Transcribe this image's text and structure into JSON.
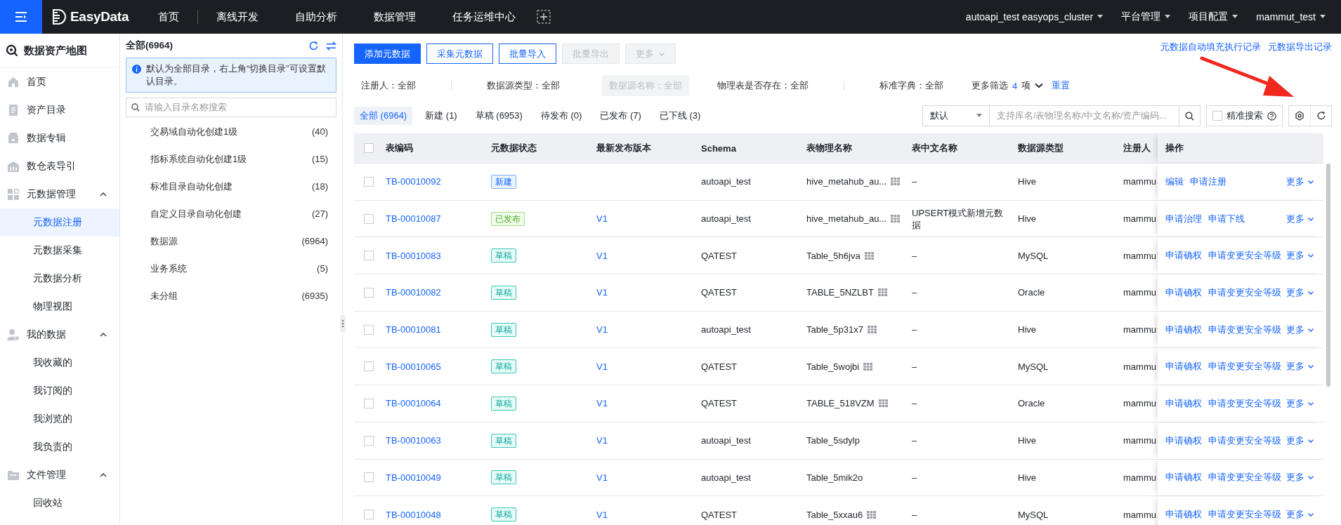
{
  "topbar": {
    "logo": "EasyData",
    "nav": [
      "首页",
      "离线开发",
      "自助分析",
      "数据管理",
      "任务运维中心"
    ],
    "menus": [
      "autoapi_test  easyops_cluster",
      "平台管理",
      "项目配置",
      "mammut_test"
    ]
  },
  "sidebar": {
    "title": "数据资产地图",
    "items": [
      {
        "label": "首页",
        "selected": false
      },
      {
        "label": "资产目录",
        "selected": false
      },
      {
        "label": "数据专辑",
        "selected": false
      },
      {
        "label": "数仓表导引",
        "selected": false
      },
      {
        "label": "元数据管理",
        "expanded": true,
        "children": [
          {
            "label": "元数据注册",
            "selected": true
          },
          {
            "label": "元数据采集",
            "selected": false
          },
          {
            "label": "元数据分析",
            "selected": false
          },
          {
            "label": "物理视图",
            "selected": false
          }
        ]
      },
      {
        "label": "我的数据",
        "expanded": true,
        "children": [
          {
            "label": "我收藏的",
            "selected": false
          },
          {
            "label": "我订阅的",
            "selected": false
          },
          {
            "label": "我浏览的",
            "selected": false
          },
          {
            "label": "我负责的",
            "selected": false
          }
        ]
      },
      {
        "label": "文件管理",
        "expanded": true,
        "children": [
          {
            "label": "回收站",
            "selected": false
          }
        ]
      }
    ]
  },
  "directory": {
    "title": "全部(6964)",
    "notice": "默认为全部目录，右上角“切换目录”可设置默认目录。",
    "search_placeholder": "请输入目录名称搜索",
    "items": [
      {
        "label": "交易域自动化创建1级",
        "count": "(40)"
      },
      {
        "label": "指标系统自动化创建1级",
        "count": "(15)"
      },
      {
        "label": "标准目录自动化创建",
        "count": "(18)"
      },
      {
        "label": "自定义目录自动化创建",
        "count": "(27)"
      },
      {
        "label": "数据源",
        "count": "(6964)"
      },
      {
        "label": "业务系统",
        "count": "(5)"
      },
      {
        "label": "未分组",
        "count": "(6935)"
      }
    ]
  },
  "actions": [
    {
      "label": "添加元数据",
      "kind": "primary",
      "disabled": false,
      "dropdown": false
    },
    {
      "label": "采集元数据",
      "kind": "outline",
      "disabled": false,
      "dropdown": false
    },
    {
      "label": "批量导入",
      "kind": "outline",
      "disabled": false,
      "dropdown": false
    },
    {
      "label": "批量导出",
      "kind": "outline",
      "disabled": true,
      "dropdown": false
    },
    {
      "label": "更多",
      "kind": "outline",
      "disabled": true,
      "dropdown": true
    }
  ],
  "record_links": [
    "元数据自动填充执行记录",
    "元数据导出记录"
  ],
  "filters": [
    {
      "label": "注册人：全部",
      "disabled": false
    },
    {
      "label": "数据源类型：全部",
      "disabled": false
    },
    {
      "label": "数据源名称：全部",
      "disabled": true
    },
    {
      "label": "物理表是否存在：全部",
      "disabled": false
    },
    {
      "label": "标准字典：全部",
      "disabled": false
    }
  ],
  "more_filters": {
    "label": "更多筛选",
    "count": "4",
    "unit": "项",
    "reset": "重置"
  },
  "status_tabs": [
    {
      "label": "全部 (6964)",
      "selected": true
    },
    {
      "label": "新建 (1)",
      "selected": false
    },
    {
      "label": "草稿 (6953)",
      "selected": false
    },
    {
      "label": "待发布 (0)",
      "selected": false
    },
    {
      "label": "已发布 (7)",
      "selected": false
    },
    {
      "label": "已下线 (3)",
      "selected": false
    }
  ],
  "search": {
    "scope": "默认",
    "placeholder": "支持库名/表物理名称/中文名称/资产编码...",
    "precise": {
      "label": "精准搜索",
      "checked": false
    }
  },
  "table": {
    "select_all_checked": false,
    "columns": [
      "表编码",
      "元数据状态",
      "最新发布版本",
      "Schema",
      "表物理名称",
      "表中文名称",
      "数据源类型",
      "注册人",
      "操作"
    ],
    "rows": [
      {
        "checked": false,
        "code": "TB-00010092",
        "status": {
          "label": "新建",
          "kind": "new"
        },
        "version": "",
        "schema": "autoapi_test",
        "physical_name": "hive_metahub_au...",
        "preview": true,
        "cn_name": "–",
        "source_type": "Hive",
        "registrant": "mammu",
        "ops": [
          "编辑",
          "申请注册"
        ],
        "more": "更多"
      },
      {
        "checked": false,
        "code": "TB-00010087",
        "status": {
          "label": "已发布",
          "kind": "published"
        },
        "version": "V1",
        "schema": "autoapi_test",
        "physical_name": "hive_metahub_au...",
        "preview": true,
        "cn_name": "UPSERT模式新增元数据",
        "source_type": "Hive",
        "registrant": "mammu",
        "ops": [
          "申请治理",
          "申请下线"
        ],
        "more": "更多"
      },
      {
        "checked": false,
        "code": "TB-00010083",
        "status": {
          "label": "草稿",
          "kind": "draft"
        },
        "version": "V1",
        "schema": "QATEST",
        "physical_name": "Table_5h6jva",
        "preview": true,
        "cn_name": "–",
        "source_type": "MySQL",
        "registrant": "mammu",
        "ops": [
          "申请确权",
          "申请变更安全等级"
        ],
        "more": "更多"
      },
      {
        "checked": false,
        "code": "TB-00010082",
        "status": {
          "label": "草稿",
          "kind": "draft"
        },
        "version": "V1",
        "schema": "QATEST",
        "physical_name": "TABLE_5NZLBT",
        "preview": true,
        "cn_name": "–",
        "source_type": "Oracle",
        "registrant": "mammu",
        "ops": [
          "申请确权",
          "申请变更安全等级"
        ],
        "more": "更多"
      },
      {
        "checked": false,
        "code": "TB-00010081",
        "status": {
          "label": "草稿",
          "kind": "draft"
        },
        "version": "V1",
        "schema": "autoapi_test",
        "physical_name": "Table_5p31x7",
        "preview": true,
        "cn_name": "–",
        "source_type": "Hive",
        "registrant": "mammu",
        "ops": [
          "申请确权",
          "申请变更安全等级"
        ],
        "more": "更多"
      },
      {
        "checked": false,
        "code": "TB-00010065",
        "status": {
          "label": "草稿",
          "kind": "draft"
        },
        "version": "V1",
        "schema": "QATEST",
        "physical_name": "Table_5wojbi",
        "preview": true,
        "cn_name": "–",
        "source_type": "MySQL",
        "registrant": "mammu",
        "ops": [
          "申请确权",
          "申请变更安全等级"
        ],
        "more": "更多"
      },
      {
        "checked": false,
        "code": "TB-00010064",
        "status": {
          "label": "草稿",
          "kind": "draft"
        },
        "version": "V1",
        "schema": "QATEST",
        "physical_name": "TABLE_518VZM",
        "preview": true,
        "cn_name": "–",
        "source_type": "Oracle",
        "registrant": "mammu",
        "ops": [
          "申请确权",
          "申请变更安全等级"
        ],
        "more": "更多"
      },
      {
        "checked": false,
        "code": "TB-00010063",
        "status": {
          "label": "草稿",
          "kind": "draft"
        },
        "version": "V1",
        "schema": "autoapi_test",
        "physical_name": "Table_5sdylp",
        "preview": false,
        "cn_name": "–",
        "source_type": "Hive",
        "registrant": "mammu",
        "ops": [
          "申请确权",
          "申请变更安全等级"
        ],
        "more": "更多"
      },
      {
        "checked": false,
        "code": "TB-00010049",
        "status": {
          "label": "草稿",
          "kind": "draft"
        },
        "version": "V1",
        "schema": "autoapi_test",
        "physical_name": "Table_5mik2o",
        "preview": false,
        "cn_name": "–",
        "source_type": "Hive",
        "registrant": "mammu",
        "ops": [
          "申请确权",
          "申请变更安全等级"
        ],
        "more": "更多"
      },
      {
        "checked": false,
        "code": "TB-00010048",
        "status": {
          "label": "草稿",
          "kind": "draft"
        },
        "version": "V1",
        "schema": "QATEST",
        "physical_name": "Table_5xxau6",
        "preview": true,
        "cn_name": "–",
        "source_type": "MySQL",
        "registrant": "mammu",
        "ops": [
          "申请确权",
          "申请变更安全等级"
        ],
        "more": "更多"
      }
    ]
  }
}
